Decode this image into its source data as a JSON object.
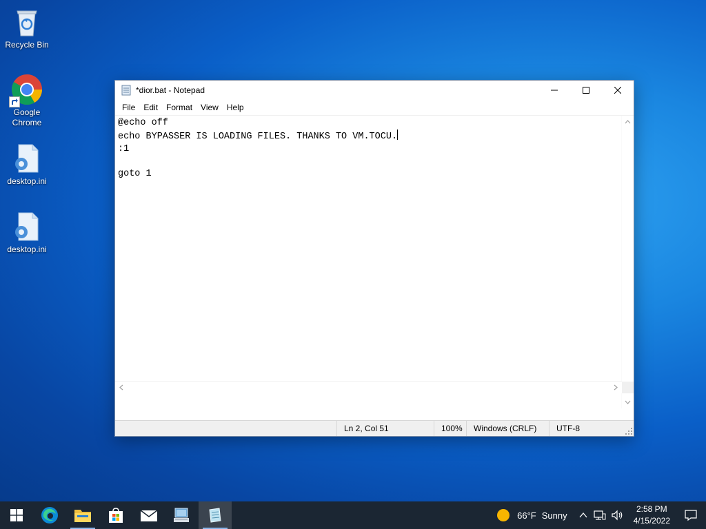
{
  "desktop": {
    "icons": [
      {
        "label": "Recycle Bin"
      },
      {
        "label": "Google\nChrome"
      },
      {
        "label": "desktop.ini"
      },
      {
        "label": "desktop.ini"
      }
    ]
  },
  "notepad": {
    "title": "*dior.bat - Notepad",
    "menu": [
      "File",
      "Edit",
      "Format",
      "View",
      "Help"
    ],
    "lines": [
      "@echo off",
      "echo BYPASSER IS LOADING FILES. THANKS TO VM.TOCU.",
      ":1",
      "",
      "goto 1"
    ],
    "status": {
      "position": "Ln 2, Col 51",
      "zoom": "100%",
      "line_ending": "Windows (CRLF)",
      "encoding": "UTF-8"
    }
  },
  "taskbar": {
    "weather_temp": "66°F",
    "weather_desc": "Sunny",
    "time": "2:58 PM",
    "date": "4/15/2022"
  },
  "colors": {
    "taskbar_bg": "#1b2633",
    "accent": "#0078d7"
  }
}
